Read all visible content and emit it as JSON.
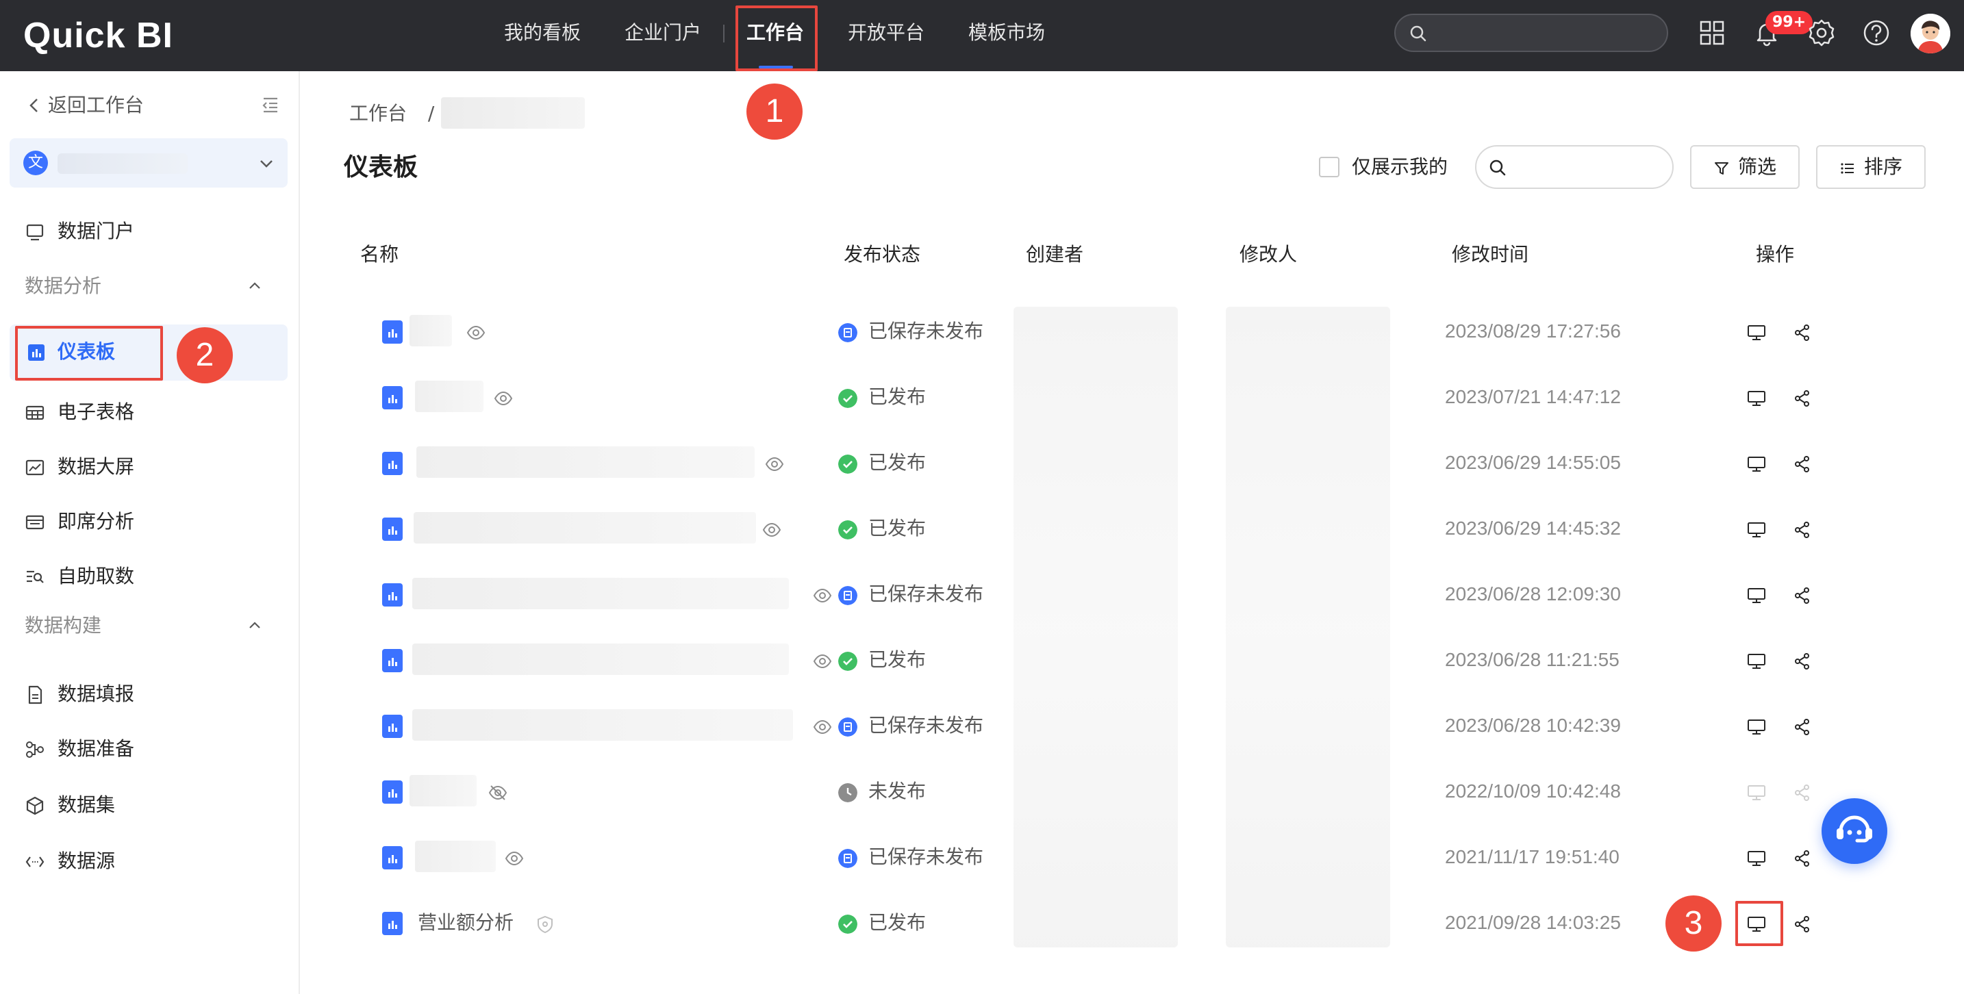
{
  "app": {
    "logo": "Quick BI"
  },
  "top_nav": {
    "items": [
      "我的看板",
      "企业门户",
      "工作台",
      "开放平台",
      "模板市场"
    ],
    "active": "工作台",
    "notifications_badge": "99+"
  },
  "sidebar": {
    "back_label": "返回工作台",
    "items": [
      {
        "label": "数据门户",
        "icon": "monitor-icon"
      },
      {
        "label": "仪表板",
        "icon": "dashboard-icon"
      },
      {
        "label": "电子表格",
        "icon": "table-icon"
      },
      {
        "label": "数据大屏",
        "icon": "chart-screen-icon"
      },
      {
        "label": "即席分析",
        "icon": "adhoc-icon"
      },
      {
        "label": "自助取数",
        "icon": "self-service-icon"
      },
      {
        "label": "数据填报",
        "icon": "form-icon"
      },
      {
        "label": "数据准备",
        "icon": "flow-icon"
      },
      {
        "label": "数据集",
        "icon": "cube-icon"
      },
      {
        "label": "数据源",
        "icon": "code-icon"
      }
    ],
    "groups": [
      "数据分析",
      "数据构建"
    ],
    "workspace_icon_char": "文"
  },
  "main": {
    "breadcrumb": "工作台",
    "breadcrumb_sep": "/",
    "title": "仪表板",
    "only_mine_label": "仅展示我的",
    "filter_label": "筛选",
    "sort_label": "排序",
    "columns": [
      "名称",
      "发布状态",
      "创建者",
      "修改人",
      "修改时间",
      "操作"
    ],
    "rows": [
      {
        "name": "",
        "status": "已保存未发布",
        "status_type": "saved",
        "time": "2023/08/29 17:27:56"
      },
      {
        "name": "",
        "status": "已发布",
        "status_type": "published",
        "time": "2023/07/21 14:47:12"
      },
      {
        "name": "",
        "status": "已发布",
        "status_type": "published",
        "time": "2023/06/29 14:55:05"
      },
      {
        "name": "",
        "status": "已发布",
        "status_type": "published",
        "time": "2023/06/29 14:45:32"
      },
      {
        "name": "",
        "status": "已保存未发布",
        "status_type": "saved",
        "time": "2023/06/28 12:09:30"
      },
      {
        "name": "",
        "status": "已发布",
        "status_type": "published",
        "time": "2023/06/28 11:21:55"
      },
      {
        "name": "",
        "status": "已保存未发布",
        "status_type": "saved",
        "time": "2023/06/28 10:42:39"
      },
      {
        "name": "",
        "status": "未发布",
        "status_type": "unpublished",
        "time": "2022/10/09 10:42:48"
      },
      {
        "name": "",
        "status": "已保存未发布",
        "status_type": "saved",
        "time": "2021/11/17 19:51:40"
      },
      {
        "name": "营业额分析",
        "status": "已发布",
        "status_type": "published",
        "time": "2021/09/28 14:03:25"
      }
    ]
  },
  "annotations": [
    "1",
    "2",
    "3"
  ],
  "colors": {
    "accent": "#2f6bf6",
    "topbar": "#2b2c30",
    "published": "#3fbf63",
    "saved": "#3c72ff",
    "unpublished": "#8c8c8c",
    "annotation": "#e8473e"
  }
}
